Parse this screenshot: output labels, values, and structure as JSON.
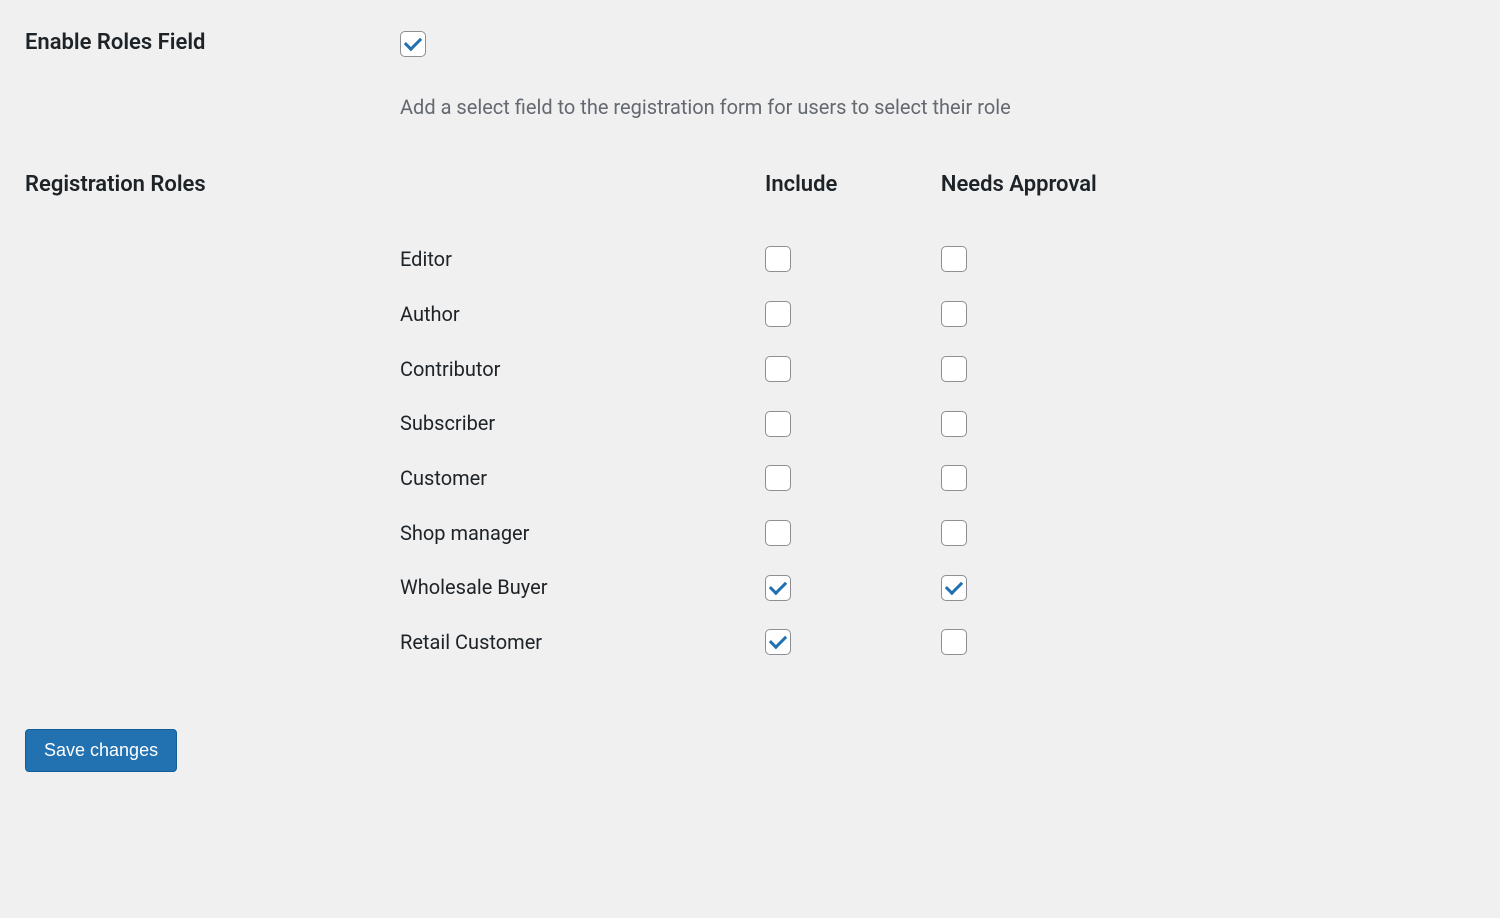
{
  "enableRoles": {
    "label": "Enable Roles Field",
    "checked": true,
    "description": "Add a select field to the registration form for users to select their role"
  },
  "registrationRoles": {
    "label": "Registration Roles",
    "columns": {
      "include": "Include",
      "needsApproval": "Needs Approval"
    },
    "roles": [
      {
        "name": "Editor",
        "include": false,
        "needsApproval": false
      },
      {
        "name": "Author",
        "include": false,
        "needsApproval": false
      },
      {
        "name": "Contributor",
        "include": false,
        "needsApproval": false
      },
      {
        "name": "Subscriber",
        "include": false,
        "needsApproval": false
      },
      {
        "name": "Customer",
        "include": false,
        "needsApproval": false
      },
      {
        "name": "Shop manager",
        "include": false,
        "needsApproval": false
      },
      {
        "name": "Wholesale Buyer",
        "include": true,
        "needsApproval": true
      },
      {
        "name": "Retail Customer",
        "include": true,
        "needsApproval": false
      }
    ]
  },
  "saveButton": {
    "label": "Save changes"
  }
}
